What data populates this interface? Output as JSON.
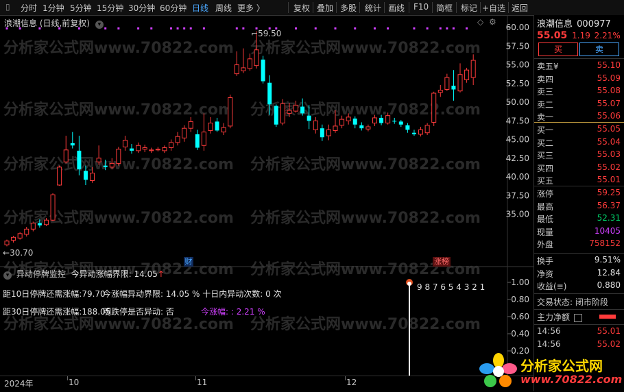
{
  "toolbar": {
    "timeframes": [
      "分时",
      "1分钟",
      "5分钟",
      "15分钟",
      "30分钟",
      "60分钟",
      "日线",
      "周线",
      "更多 〉"
    ],
    "active_timeframe": "日线",
    "buttons": [
      "复权",
      "叠加",
      "多股",
      "统计",
      "画线",
      "F10",
      "简框",
      "标记",
      "+自选",
      "返回"
    ]
  },
  "chart": {
    "title": "浪潮信息 (日线,前复权)",
    "y_ticks": [
      "60.00",
      "57.50",
      "55.00",
      "52.50",
      "50.00",
      "47.50",
      "45.00",
      "42.50",
      "40.00",
      "37.50",
      "35.00"
    ],
    "high_label": "59.50",
    "low_label": "30.70",
    "event_cai": "财",
    "event_zhangbang": "涨榜"
  },
  "chart_data": {
    "type": "candlestick",
    "y_range": [
      30.0,
      60.5
    ],
    "candles": [
      {
        "o": 30.9,
        "c": 31.4,
        "h": 31.6,
        "l": 30.7
      },
      {
        "o": 31.5,
        "c": 31.9,
        "h": 32.1,
        "l": 31.2
      },
      {
        "o": 31.8,
        "c": 32.4,
        "h": 32.6,
        "l": 31.6
      },
      {
        "o": 32.3,
        "c": 33.0,
        "h": 33.3,
        "l": 32.0
      },
      {
        "o": 33.0,
        "c": 33.8,
        "h": 34.0,
        "l": 32.7
      },
      {
        "o": 33.8,
        "c": 33.5,
        "h": 34.3,
        "l": 33.2
      },
      {
        "o": 33.6,
        "c": 34.2,
        "h": 34.5,
        "l": 33.4
      },
      {
        "o": 34.2,
        "c": 37.6,
        "h": 37.8,
        "l": 34.1
      },
      {
        "o": 38.9,
        "c": 41.3,
        "h": 41.5,
        "l": 38.8
      },
      {
        "o": 42.0,
        "c": 43.6,
        "h": 45.5,
        "l": 41.8
      },
      {
        "o": 44.5,
        "c": 44.2,
        "h": 46.0,
        "l": 43.8
      },
      {
        "o": 43.5,
        "c": 41.0,
        "h": 45.5,
        "l": 40.2
      },
      {
        "o": 40.8,
        "c": 39.6,
        "h": 41.5,
        "l": 38.9
      },
      {
        "o": 39.5,
        "c": 40.5,
        "h": 41.3,
        "l": 39.2
      },
      {
        "o": 42.0,
        "c": 42.5,
        "h": 44.2,
        "l": 41.6
      },
      {
        "o": 41.5,
        "c": 41.3,
        "h": 42.3,
        "l": 40.9
      },
      {
        "o": 41.3,
        "c": 41.8,
        "h": 42.5,
        "l": 41.0
      },
      {
        "o": 41.8,
        "c": 43.7,
        "h": 44.0,
        "l": 41.5
      },
      {
        "o": 44.0,
        "c": 44.9,
        "h": 45.5,
        "l": 43.5
      },
      {
        "o": 43.8,
        "c": 43.5,
        "h": 44.4,
        "l": 43.1
      },
      {
        "o": 43.5,
        "c": 44.2,
        "h": 44.6,
        "l": 43.2
      },
      {
        "o": 43.7,
        "c": 43.9,
        "h": 44.3,
        "l": 43.3
      },
      {
        "o": 43.5,
        "c": 43.6,
        "h": 43.9,
        "l": 43.2
      },
      {
        "o": 43.6,
        "c": 43.7,
        "h": 44.0,
        "l": 43.4
      },
      {
        "o": 43.5,
        "c": 43.9,
        "h": 44.2,
        "l": 43.2
      },
      {
        "o": 43.9,
        "c": 44.6,
        "h": 45.0,
        "l": 43.5
      },
      {
        "o": 44.6,
        "c": 45.4,
        "h": 46.0,
        "l": 44.2
      },
      {
        "o": 45.2,
        "c": 46.5,
        "h": 46.9,
        "l": 44.7
      },
      {
        "o": 46.5,
        "c": 47.4,
        "h": 48.0,
        "l": 46.0
      },
      {
        "o": 45.7,
        "c": 43.9,
        "h": 46.3,
        "l": 43.6
      },
      {
        "o": 44.2,
        "c": 46.0,
        "h": 48.5,
        "l": 43.5
      },
      {
        "o": 46.2,
        "c": 47.2,
        "h": 48.0,
        "l": 45.8
      },
      {
        "o": 47.4,
        "c": 46.2,
        "h": 47.9,
        "l": 46.0
      },
      {
        "o": 46.0,
        "c": 46.6,
        "h": 47.2,
        "l": 45.6
      },
      {
        "o": 46.8,
        "c": 50.6,
        "h": 51.0,
        "l": 46.5
      },
      {
        "o": 53.8,
        "c": 55.0,
        "h": 56.8,
        "l": 53.5
      },
      {
        "o": 54.2,
        "c": 54.6,
        "h": 57.2,
        "l": 53.9
      },
      {
        "o": 54.5,
        "c": 55.8,
        "h": 56.5,
        "l": 54.2
      },
      {
        "o": 54.9,
        "c": 57.0,
        "h": 59.5,
        "l": 54.5
      },
      {
        "o": 55.7,
        "c": 52.8,
        "h": 56.2,
        "l": 52.5
      },
      {
        "o": 52.6,
        "c": 49.7,
        "h": 53.6,
        "l": 48.3
      },
      {
        "o": 49.5,
        "c": 47.0,
        "h": 49.7,
        "l": 46.7
      },
      {
        "o": 47.2,
        "c": 49.8,
        "h": 50.4,
        "l": 46.9
      },
      {
        "o": 48.5,
        "c": 48.9,
        "h": 49.9,
        "l": 48.0
      },
      {
        "o": 48.8,
        "c": 49.6,
        "h": 50.2,
        "l": 48.6
      },
      {
        "o": 49.4,
        "c": 48.5,
        "h": 50.5,
        "l": 48.2
      },
      {
        "o": 48.2,
        "c": 47.5,
        "h": 49.6,
        "l": 46.4
      },
      {
        "o": 46.3,
        "c": 47.5,
        "h": 48.0,
        "l": 45.8
      },
      {
        "o": 46.5,
        "c": 45.3,
        "h": 47.0,
        "l": 44.8
      },
      {
        "o": 45.5,
        "c": 46.3,
        "h": 47.0,
        "l": 44.9
      },
      {
        "o": 46.2,
        "c": 46.8,
        "h": 48.9,
        "l": 45.9
      },
      {
        "o": 46.9,
        "c": 47.7,
        "h": 48.2,
        "l": 46.5
      },
      {
        "o": 47.5,
        "c": 48.0,
        "h": 48.5,
        "l": 47.0
      },
      {
        "o": 47.8,
        "c": 47.0,
        "h": 48.1,
        "l": 46.5
      },
      {
        "o": 46.9,
        "c": 46.5,
        "h": 47.3,
        "l": 46.2
      },
      {
        "o": 46.4,
        "c": 46.7,
        "h": 47.0,
        "l": 46.1
      },
      {
        "o": 47.2,
        "c": 47.9,
        "h": 48.3,
        "l": 46.8
      },
      {
        "o": 47.9,
        "c": 47.2,
        "h": 48.3,
        "l": 46.9
      },
      {
        "o": 47.2,
        "c": 48.2,
        "h": 48.6,
        "l": 47.0
      },
      {
        "o": 47.5,
        "c": 47.4,
        "h": 47.9,
        "l": 47.1
      },
      {
        "o": 47.4,
        "c": 47.0,
        "h": 47.6,
        "l": 46.7
      },
      {
        "o": 46.9,
        "c": 46.3,
        "h": 47.2,
        "l": 45.9
      },
      {
        "o": 45.9,
        "c": 45.7,
        "h": 46.3,
        "l": 45.5
      },
      {
        "o": 45.7,
        "c": 46.3,
        "h": 46.7,
        "l": 45.4
      },
      {
        "o": 45.9,
        "c": 46.9,
        "h": 47.2,
        "l": 45.6
      },
      {
        "o": 47.3,
        "c": 51.2,
        "h": 51.4,
        "l": 46.8
      },
      {
        "o": 51.3,
        "c": 51.6,
        "h": 52.3,
        "l": 50.7
      },
      {
        "o": 51.7,
        "c": 53.3,
        "h": 53.8,
        "l": 51.5
      },
      {
        "o": 52.2,
        "c": 51.7,
        "h": 54.3,
        "l": 50.2
      },
      {
        "o": 51.5,
        "c": 53.7,
        "h": 55.2,
        "l": 51.3
      },
      {
        "o": 53.0,
        "c": 54.3,
        "h": 54.6,
        "l": 52.6
      },
      {
        "o": 53.3,
        "c": 55.6,
        "h": 56.4,
        "l": 52.3
      }
    ]
  },
  "indicator": {
    "title": "异动停牌监控",
    "boundary_label": "今异动涨幅界限:",
    "boundary_value": "14.05",
    "boundary_arrow": "↑",
    "line1_a": "距10日停牌还需涨幅:",
    "line1_b": "79.70",
    "line1_c": "今涨幅异动界限:",
    "line1_d": "14.05 %",
    "line1_e": "十日内异动次数:",
    "line1_f": "0 次",
    "line2_a": "距30日停牌还需涨幅:",
    "line2_b": "188.05",
    "line2_c": "明跌停是否异动:",
    "line2_d": "否",
    "line2_e": "今涨幅: :",
    "line2_f": "2.21 %",
    "countdown": "9 8 7 6 5 4 3 2 1",
    "y_ticks": [
      "1.00",
      "0.80",
      "0.60",
      "0.40",
      "0.20"
    ]
  },
  "dates": [
    "2024年",
    "10",
    "11",
    "12"
  ],
  "right": {
    "name": "浪潮信息",
    "code": "000977",
    "price": "55.05",
    "change": "1.19",
    "pct": "2.21%",
    "buy_btn": "买",
    "sell_btn": "卖",
    "asks": [
      {
        "label": "卖五",
        "mark": "¥",
        "price": "55.10"
      },
      {
        "label": "卖四",
        "mark": "",
        "price": "55.09"
      },
      {
        "label": "卖三",
        "mark": "",
        "price": "55.08"
      },
      {
        "label": "卖二",
        "mark": "",
        "price": "55.07"
      },
      {
        "label": "卖一",
        "mark": "",
        "price": "55.06"
      }
    ],
    "bids": [
      {
        "label": "买一",
        "price": "55.05"
      },
      {
        "label": "买二",
        "price": "55.04"
      },
      {
        "label": "买三",
        "price": "55.03"
      },
      {
        "label": "买四",
        "price": "55.02"
      },
      {
        "label": "买五",
        "price": "55.01"
      }
    ],
    "stats1": [
      {
        "label": "涨停",
        "value": "59.25",
        "cls": "red"
      },
      {
        "label": "最高",
        "value": "56.37",
        "cls": "red"
      },
      {
        "label": "最低",
        "value": "52.31",
        "cls": "green"
      },
      {
        "label": "现量",
        "value": "10405 ",
        "cls": "purple"
      },
      {
        "label": "外盘",
        "value": "758152",
        "cls": "red"
      }
    ],
    "stats2": [
      {
        "label": "换手",
        "value": "9.51%",
        "cls": "white"
      },
      {
        "label": "净资",
        "value": "12.84",
        "cls": "white"
      },
      {
        "label": "收益(≡)",
        "value": "0.880",
        "cls": "white"
      }
    ],
    "status_label": "交易状态:",
    "status_value": "闭市阶段",
    "netflow_label": "主力净额",
    "ticks": [
      {
        "time": "14:56",
        "price": "55.01"
      },
      {
        "time": "14:56",
        "price": "55.02"
      }
    ]
  },
  "watermark": "分析家公式网www.70822.com",
  "logo": {
    "name": "分析家公式网",
    "url": "www.70822.com"
  },
  "colors": {
    "up": "#ff3b3b",
    "down": "#00ffff",
    "purple": "#d040ff",
    "accent": "#4aa8ff"
  }
}
